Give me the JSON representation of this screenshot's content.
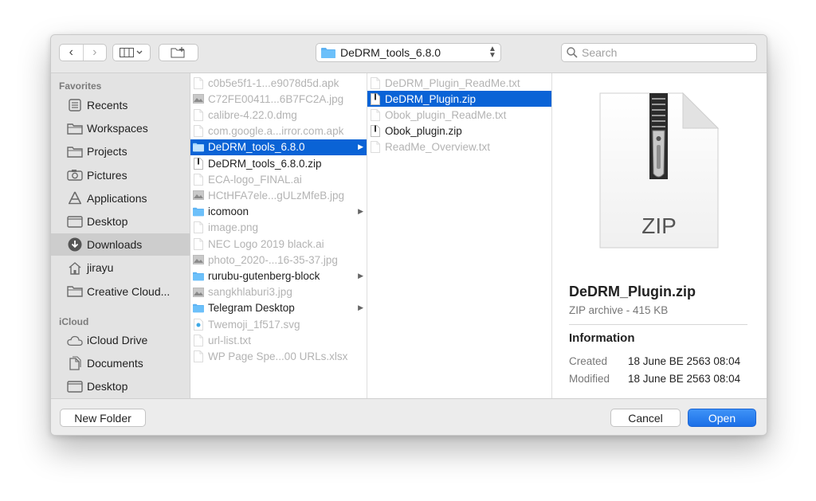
{
  "toolbar": {
    "back_glyph": "‹",
    "forward_glyph": "›",
    "path_label": "DeDRM_tools_6.8.0",
    "search_placeholder": "Search"
  },
  "sidebar": {
    "favorites_header": "Favorites",
    "favorites": [
      {
        "label": "Recents",
        "icon": "recents-icon"
      },
      {
        "label": "Workspaces",
        "icon": "folder-icon"
      },
      {
        "label": "Projects",
        "icon": "folder-icon"
      },
      {
        "label": "Pictures",
        "icon": "camera-icon"
      },
      {
        "label": "Applications",
        "icon": "applications-icon"
      },
      {
        "label": "Desktop",
        "icon": "desktop-icon"
      },
      {
        "label": "Downloads",
        "icon": "download-icon",
        "selected": true
      },
      {
        "label": "jirayu",
        "icon": "home-icon"
      },
      {
        "label": "Creative Cloud...",
        "icon": "folder-icon"
      }
    ],
    "icloud_header": "iCloud",
    "icloud": [
      {
        "label": "iCloud Drive",
        "icon": "cloud-icon"
      },
      {
        "label": "Documents",
        "icon": "documents-icon"
      },
      {
        "label": "Desktop",
        "icon": "desktop-icon"
      }
    ]
  },
  "column1": [
    {
      "name": "c0b5e5f1-1...e9078d5d.apk",
      "type": "file"
    },
    {
      "name": "C72FE00411...6B7FC2A.jpg",
      "type": "image"
    },
    {
      "name": "calibre-4.22.0.dmg",
      "type": "file"
    },
    {
      "name": "com.google.a...irror.com.apk",
      "type": "file"
    },
    {
      "name": "DeDRM_tools_6.8.0",
      "type": "folder",
      "selected": true
    },
    {
      "name": "DeDRM_tools_6.8.0.zip",
      "type": "zip",
      "enabled": true
    },
    {
      "name": "ECA-logo_FINAL.ai",
      "type": "file"
    },
    {
      "name": "HCtHFA7ele...gULzMfeB.jpg",
      "type": "image"
    },
    {
      "name": "icomoon",
      "type": "folder",
      "enabled": true
    },
    {
      "name": "image.png",
      "type": "file"
    },
    {
      "name": "NEC Logo 2019 black.ai",
      "type": "file"
    },
    {
      "name": "photo_2020-...16-35-37.jpg",
      "type": "image"
    },
    {
      "name": "rurubu-gutenberg-block",
      "type": "folder",
      "enabled": true
    },
    {
      "name": "sangkhlaburi3.jpg",
      "type": "image"
    },
    {
      "name": "Telegram Desktop",
      "type": "folder",
      "enabled": true
    },
    {
      "name": "Twemoji_1f517.svg",
      "type": "svg"
    },
    {
      "name": "url-list.txt",
      "type": "file"
    },
    {
      "name": "WP Page Spe...00 URLs.xlsx",
      "type": "file"
    }
  ],
  "column2": [
    {
      "name": "DeDRM_Plugin_ReadMe.txt",
      "type": "file"
    },
    {
      "name": "DeDRM_Plugin.zip",
      "type": "zip",
      "selected": true
    },
    {
      "name": "Obok_plugin_ReadMe.txt",
      "type": "file"
    },
    {
      "name": "Obok_plugin.zip",
      "type": "zip",
      "enabled": true
    },
    {
      "name": "ReadMe_Overview.txt",
      "type": "file"
    }
  ],
  "preview": {
    "icon_text": "ZIP",
    "file_name": "DeDRM_Plugin.zip",
    "kind": "ZIP archive - 415 KB",
    "info_header": "Information",
    "created_label": "Created",
    "created_value": "18 June BE 2563 08:04",
    "modified_label": "Modified",
    "modified_value": "18 June BE 2563 08:04"
  },
  "buttons": {
    "new_folder": "New Folder",
    "cancel": "Cancel",
    "open": "Open"
  },
  "colors": {
    "accent": "#0a63d6",
    "sidebar_icon": "#6b6b6b"
  }
}
